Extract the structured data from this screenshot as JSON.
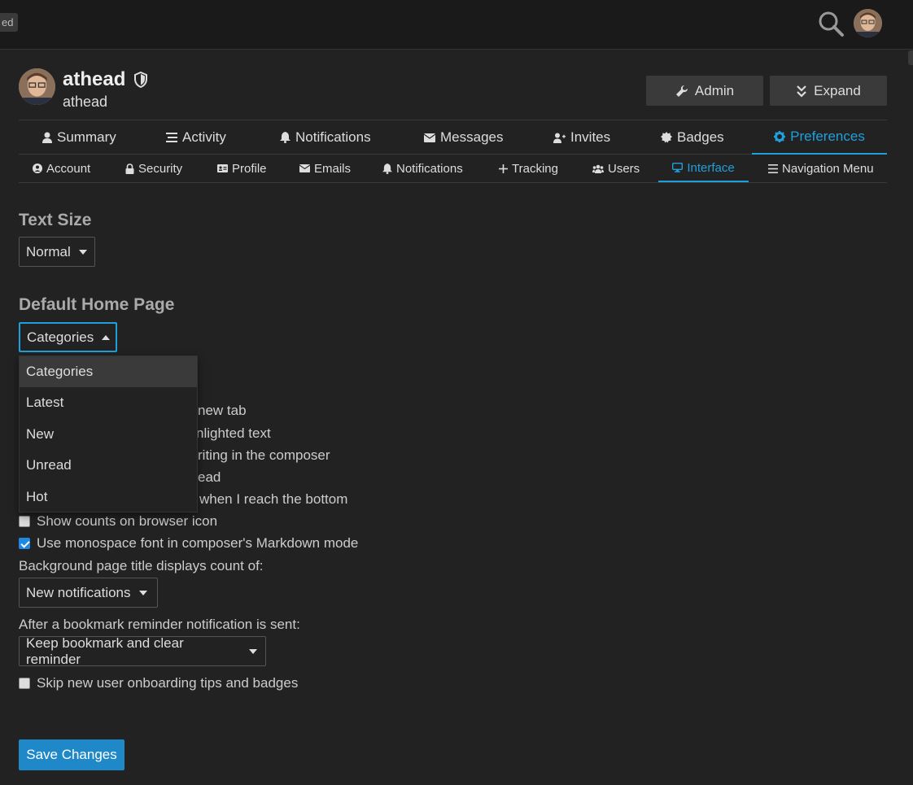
{
  "header": {
    "left_badge": "ed",
    "search_icon": "search-icon"
  },
  "user": {
    "username": "athead",
    "name": "athead",
    "admin_label": "Admin",
    "expand_label": "Expand"
  },
  "main_nav": [
    {
      "label": "Summary",
      "icon": "user-icon"
    },
    {
      "label": "Activity",
      "icon": "list-icon"
    },
    {
      "label": "Notifications",
      "icon": "bell-icon"
    },
    {
      "label": "Messages",
      "icon": "envelope-icon"
    },
    {
      "label": "Invites",
      "icon": "user-plus-icon"
    },
    {
      "label": "Badges",
      "icon": "certificate-icon"
    },
    {
      "label": "Preferences",
      "icon": "gear-icon",
      "active": true
    }
  ],
  "sub_nav": [
    {
      "label": "Account",
      "icon": "user-circle-icon"
    },
    {
      "label": "Security",
      "icon": "lock-icon"
    },
    {
      "label": "Profile",
      "icon": "id-card-icon"
    },
    {
      "label": "Emails",
      "icon": "envelope-icon"
    },
    {
      "label": "Notifications",
      "icon": "bell-icon"
    },
    {
      "label": "Tracking",
      "icon": "plus-icon"
    },
    {
      "label": "Users",
      "icon": "users-icon"
    },
    {
      "label": "Interface",
      "icon": "desktop-icon",
      "active": true
    },
    {
      "label": "Navigation Menu",
      "icon": "bars-icon"
    }
  ],
  "text_size": {
    "title": "Text Size",
    "value": "Normal"
  },
  "home_page": {
    "title": "Default Home Page",
    "value": "Categories",
    "options": [
      "Categories",
      "Latest",
      "New",
      "Unread",
      "Hot"
    ]
  },
  "partial_lines": [
    "new tab",
    "nlighted text",
    "riting in the composer",
    "ead",
    "when I reach the bottom"
  ],
  "checkboxes": [
    {
      "label": "Show counts on browser icon",
      "checked": false
    },
    {
      "label": "Use monospace font in composer's Markdown mode",
      "checked": true
    }
  ],
  "title_count": {
    "label": "Background page title displays count of:",
    "value": "New notifications"
  },
  "bookmark": {
    "label": "After a bookmark reminder notification is sent:",
    "value": "Keep bookmark and clear reminder"
  },
  "skip_onboarding": {
    "label": "Skip new user onboarding tips and badges",
    "checked": false
  },
  "save_label": "Save Changes",
  "colors": {
    "accent": "#1ea0dc",
    "background": "#222222",
    "save": "#1e88c8"
  }
}
